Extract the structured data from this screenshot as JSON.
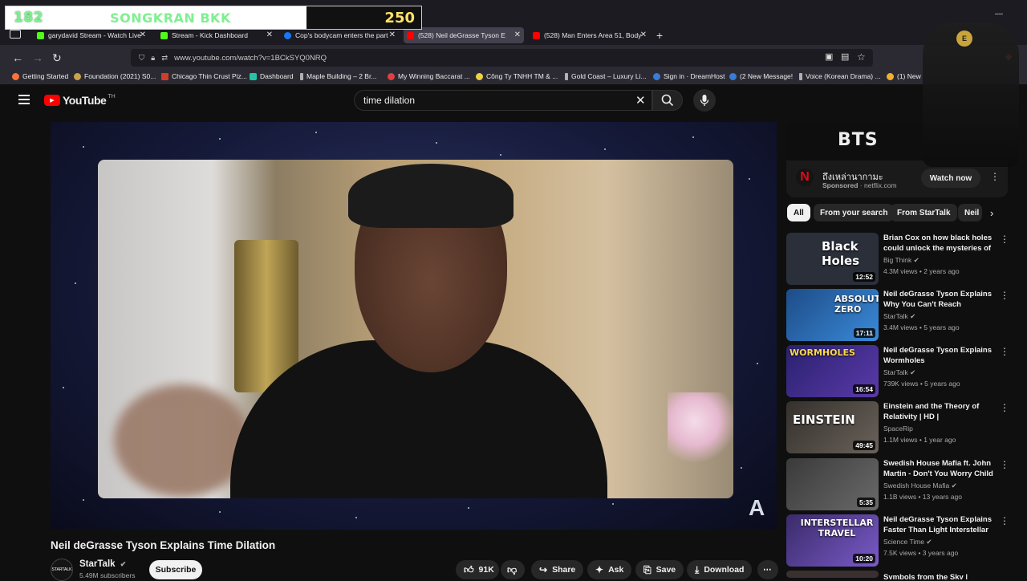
{
  "overlay": {
    "left_number": "182",
    "title": "SONGKRAN BKK",
    "score": "250"
  },
  "browser": {
    "tabs": [
      {
        "label": "garydavid Stream - Watch Live",
        "icon_color": "#53fc18"
      },
      {
        "label": "Stream - Kick Dashboard",
        "icon_color": "#53fc18"
      },
      {
        "label": "Cop's bodycam enters the part",
        "icon_color": "#1877f2"
      },
      {
        "label": "(528) Neil deGrasse Tyson E",
        "icon_color": "#ff0000"
      },
      {
        "label": "(528) Man Enters Area 51, Body",
        "icon_color": "#ff0000"
      }
    ],
    "new_tab": "+",
    "url": "www.youtube.com/watch?v=1BCkSYQ0NRQ",
    "bookmarks": [
      {
        "label": "Getting Started",
        "icon_color": "#ff7139"
      },
      {
        "label": "Foundation (2021) S0...",
        "icon_color": "#c8a34a"
      },
      {
        "label": "Chicago Thin Crust Piz...",
        "icon_color": "#d23c2a"
      },
      {
        "label": "Dashboard",
        "icon_color": "#24c4a8"
      },
      {
        "label": "Maple Building – 2 Br...",
        "icon_color": "#b0b0b0"
      },
      {
        "label": "My Winning Baccarat ...",
        "icon_color": "#e04040"
      },
      {
        "label": "Công Ty TNHH TM & ...",
        "icon_color": "#f0d040"
      },
      {
        "label": "Gold Coast – Luxury Li...",
        "icon_color": "#b0b0b0"
      },
      {
        "label": "Sign in · DreamHost",
        "icon_color": "#3a7bd5"
      },
      {
        "label": "(2 New Message!",
        "icon_color": "#3a7bd5"
      },
      {
        "label": "Voice (Korean Drama) ...",
        "icon_color": "#b0b0b0"
      },
      {
        "label": "(1) New",
        "icon_color": "#f0b030"
      }
    ]
  },
  "youtube": {
    "logo_text": "YouTube",
    "country": "TH",
    "search": {
      "value": "time dilation"
    }
  },
  "video": {
    "title": "Neil deGrasse Tyson Explains Time Dilation",
    "channel": "StarTalk",
    "subscribers": "5.49M subscribers",
    "avatar_text": "STARTALK",
    "subscribe_label": "Subscribe",
    "likes": "91K",
    "share_label": "Share",
    "ask_label": "Ask",
    "save_label": "Save",
    "download_label": "Download",
    "watermark": "A"
  },
  "ad": {
    "banner_text": "BTS",
    "title": "ถึงเหล่านากามะ",
    "sponsored": "Sponsored",
    "domain": "netflix.com",
    "cta": "Watch now",
    "logo": "N"
  },
  "chips": [
    "All",
    "From your search",
    "From StarTalk",
    "Neil"
  ],
  "recommendations": [
    {
      "title": "Brian Cox on how black holes could unlock the mysteries of ...",
      "channel": "Big Think",
      "meta": "4.3M views • 2 years ago",
      "duration": "12:52",
      "thumb_text": "Black Holes",
      "thumb_color": "#2a2f3a"
    },
    {
      "title": "Neil deGrasse Tyson Explains Why You Can't Reach Absolute...",
      "channel": "StarTalk",
      "meta": "3.4M views • 5 years ago",
      "duration": "17:11",
      "thumb_text": "ABSOLUTE ZERO",
      "thumb_color": "#1d4c88"
    },
    {
      "title": "Neil deGrasse Tyson Explains Wormholes",
      "channel": "StarTalk",
      "meta": "739K views • 5 years ago",
      "duration": "16:54",
      "thumb_text": "WORMHOLES",
      "thumb_color": "#2a2170"
    },
    {
      "title": "Einstein and the Theory of Relativity | HD |",
      "channel": "SpaceRip",
      "meta": "1.1M views • 1 year ago",
      "duration": "49:45",
      "thumb_text": "EINSTEIN",
      "thumb_color": "#34302c"
    },
    {
      "title": "Swedish House Mafia ft. John Martin - Don't You Worry Child ...",
      "channel": "Swedish House Mafia",
      "meta": "1.1B views • 13 years ago",
      "duration": "5:35",
      "thumb_text": "",
      "thumb_color": "#4a4a4a"
    },
    {
      "title": "Neil deGrasse Tyson Explains Faster Than Light Interstellar ...",
      "channel": "Science Time",
      "meta": "7.5K views • 3 years ago",
      "duration": "10:20",
      "thumb_text": "INTERSTELLAR TRAVEL",
      "thumb_color": "#3a2b6a"
    },
    {
      "title": "Symbols from the Sky | Ancient ...",
      "channel": "",
      "meta": "",
      "duration": "",
      "thumb_text": "",
      "thumb_color": "#3a3030"
    }
  ],
  "streamer_chair": {
    "logo": "E"
  }
}
